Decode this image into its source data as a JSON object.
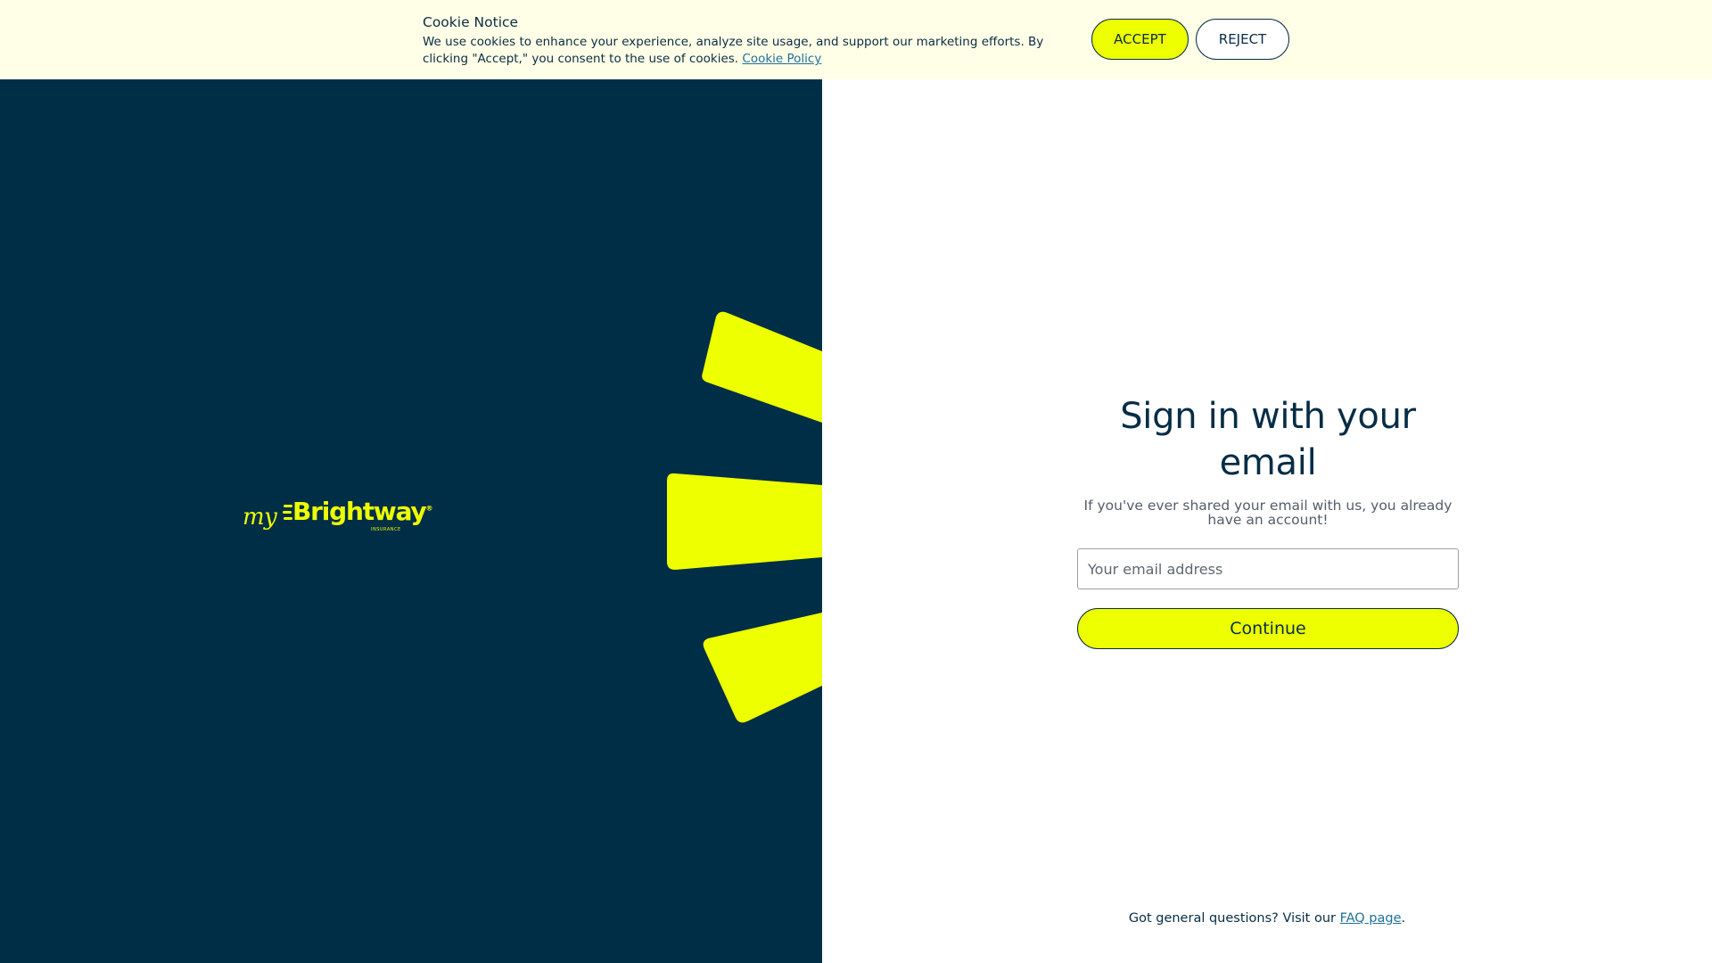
{
  "cookie_banner": {
    "title": "Cookie Notice",
    "body": "We use cookies to enhance your experience, analyze site usage, and support our marketing efforts. By clicking \"Accept,\" you consent to the use of cookies.",
    "policy_link": "Cookie Policy",
    "accept_label": "ACCEPT",
    "reject_label": "REJECT"
  },
  "brand": {
    "prefix": "my",
    "name": "Brightway",
    "trademark": "®",
    "subline": "INSURANCE"
  },
  "signin": {
    "title": "Sign in with your email",
    "subtitle": "If you've ever shared your email with us, you already have an account!",
    "email_placeholder": "Your email address",
    "email_value": "",
    "continue_label": "Continue"
  },
  "footer": {
    "prefix": "Got general questions? Visit our ",
    "faq_link": "FAQ page",
    "suffix": "."
  },
  "colors": {
    "navy": "#002e47",
    "accent_yellow": "#eeff00",
    "banner_bg": "#ffffe8",
    "link_blue": "#1f6f9a"
  }
}
